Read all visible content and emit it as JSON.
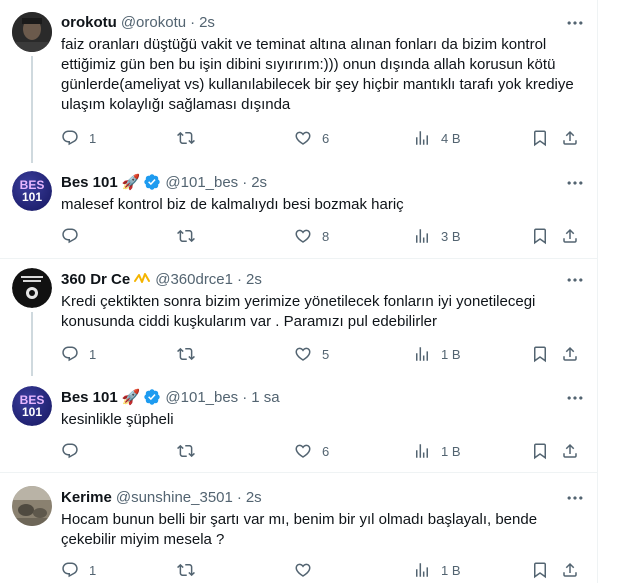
{
  "tweets": [
    {
      "name": "orokotu",
      "handle": "@orokotu",
      "time": "2s",
      "text": "faiz oranları düştüğü vakit ve teminat altına alınan fonları da bizim kontrol ettiğimiz gün ben bu işin dibini sıyırırım:))) onun dışında allah korusun kötü günlerde(ameliyat vs) kullanılabilecek bir şey hiçbir mantıklı tarafı yok krediye ulaşım kolaylığı sağlaması dışında",
      "replies": "1",
      "retweets": "",
      "likes": "6",
      "views": "4 B"
    },
    {
      "name": "Bes 101",
      "name_emoji": "🚀",
      "handle": "@101_bes",
      "time": "2s",
      "text": "malesef kontrol biz de kalmalıydı besi bozmak hariç",
      "replies": "",
      "retweets": "",
      "likes": "8",
      "views": "3 B",
      "avatar_text": [
        "BES",
        "101"
      ]
    },
    {
      "name": "360 Dr Ce",
      "handle": "@360drce1",
      "time": "2s",
      "text": "Kredi çektikten sonra bizim yerimize yönetilecek fonların iyi yonetilecegi konusunda ciddi kuşkularım var . Paramızı pul edebilirler",
      "replies": "1",
      "retweets": "",
      "likes": "5",
      "views": "1 B"
    },
    {
      "name": "Bes 101",
      "name_emoji": "🚀",
      "handle": "@101_bes",
      "time": "1 sa",
      "text": "kesinlikle şüpheli",
      "replies": "",
      "retweets": "",
      "likes": "6",
      "views": "1 B",
      "avatar_text": [
        "BES",
        "101"
      ]
    },
    {
      "name": "Kerime",
      "handle": "@sunshine_3501",
      "time": "2s",
      "text": "Hocam bunun belli bir şartı var mı, benim bir yıl olmadı başlayalı, bende çekebilir miyim mesela ?",
      "replies": "1",
      "retweets": "",
      "likes": "",
      "views": "1 B"
    }
  ],
  "colors": {
    "text": "#0f1419",
    "secondary": "#536471",
    "verified": "#1d9bf0",
    "gold": "#f4b400",
    "thread": "#cfd9de",
    "border": "#eff3f4"
  },
  "icons": [
    "reply-icon",
    "retweet-icon",
    "like-icon",
    "views-icon",
    "bookmark-icon",
    "share-icon",
    "more-icon",
    "verified-badge-icon",
    "gold-badge-icon"
  ]
}
